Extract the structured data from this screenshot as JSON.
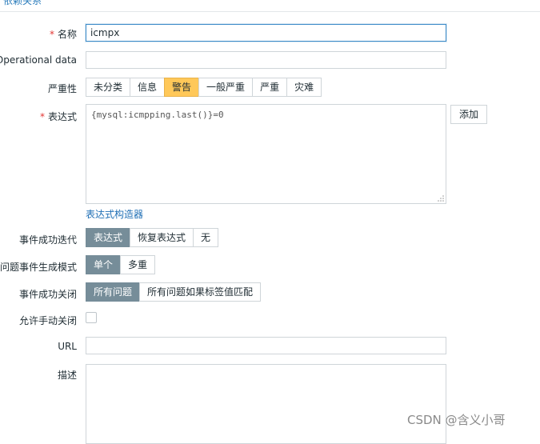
{
  "top_tab": "依赖关系",
  "labels": {
    "name": "名称",
    "operational_data": "Operational data",
    "severity": "严重性",
    "expression": "表达式",
    "ok_event_generation": "事件成功迭代",
    "problem_event_mode": "问题事件生成模式",
    "ok_event_closes": "事件成功关闭",
    "allow_manual_close": "允许手动关闭",
    "url": "URL",
    "description": "描述"
  },
  "required_mark": "*",
  "fields": {
    "name_value": "icmpx",
    "operational_data_value": "",
    "expression_value": "{mysql:icmpping.last()}=0",
    "url_value": ""
  },
  "severity_options": [
    "未分类",
    "信息",
    "警告",
    "一般严重",
    "严重",
    "灾难"
  ],
  "severity_selected": "警告",
  "add_button": "添加",
  "expression_builder_link": "表达式构造器",
  "ok_event_generation_options": [
    "表达式",
    "恢复表达式",
    "无"
  ],
  "ok_event_generation_selected": "表达式",
  "problem_mode_options": [
    "单个",
    "多重"
  ],
  "problem_mode_selected": "单个",
  "ok_event_closes_options": [
    "所有问题",
    "所有问题如果标签值匹配"
  ],
  "ok_event_closes_selected": "所有问题",
  "allow_manual_close_checked": false,
  "watermark": "CSDN @含义小哥",
  "colors": {
    "active_segment": "#768d99",
    "warning_segment": "#ffc859",
    "required": "#e33734",
    "link": "#1f6fb5"
  }
}
